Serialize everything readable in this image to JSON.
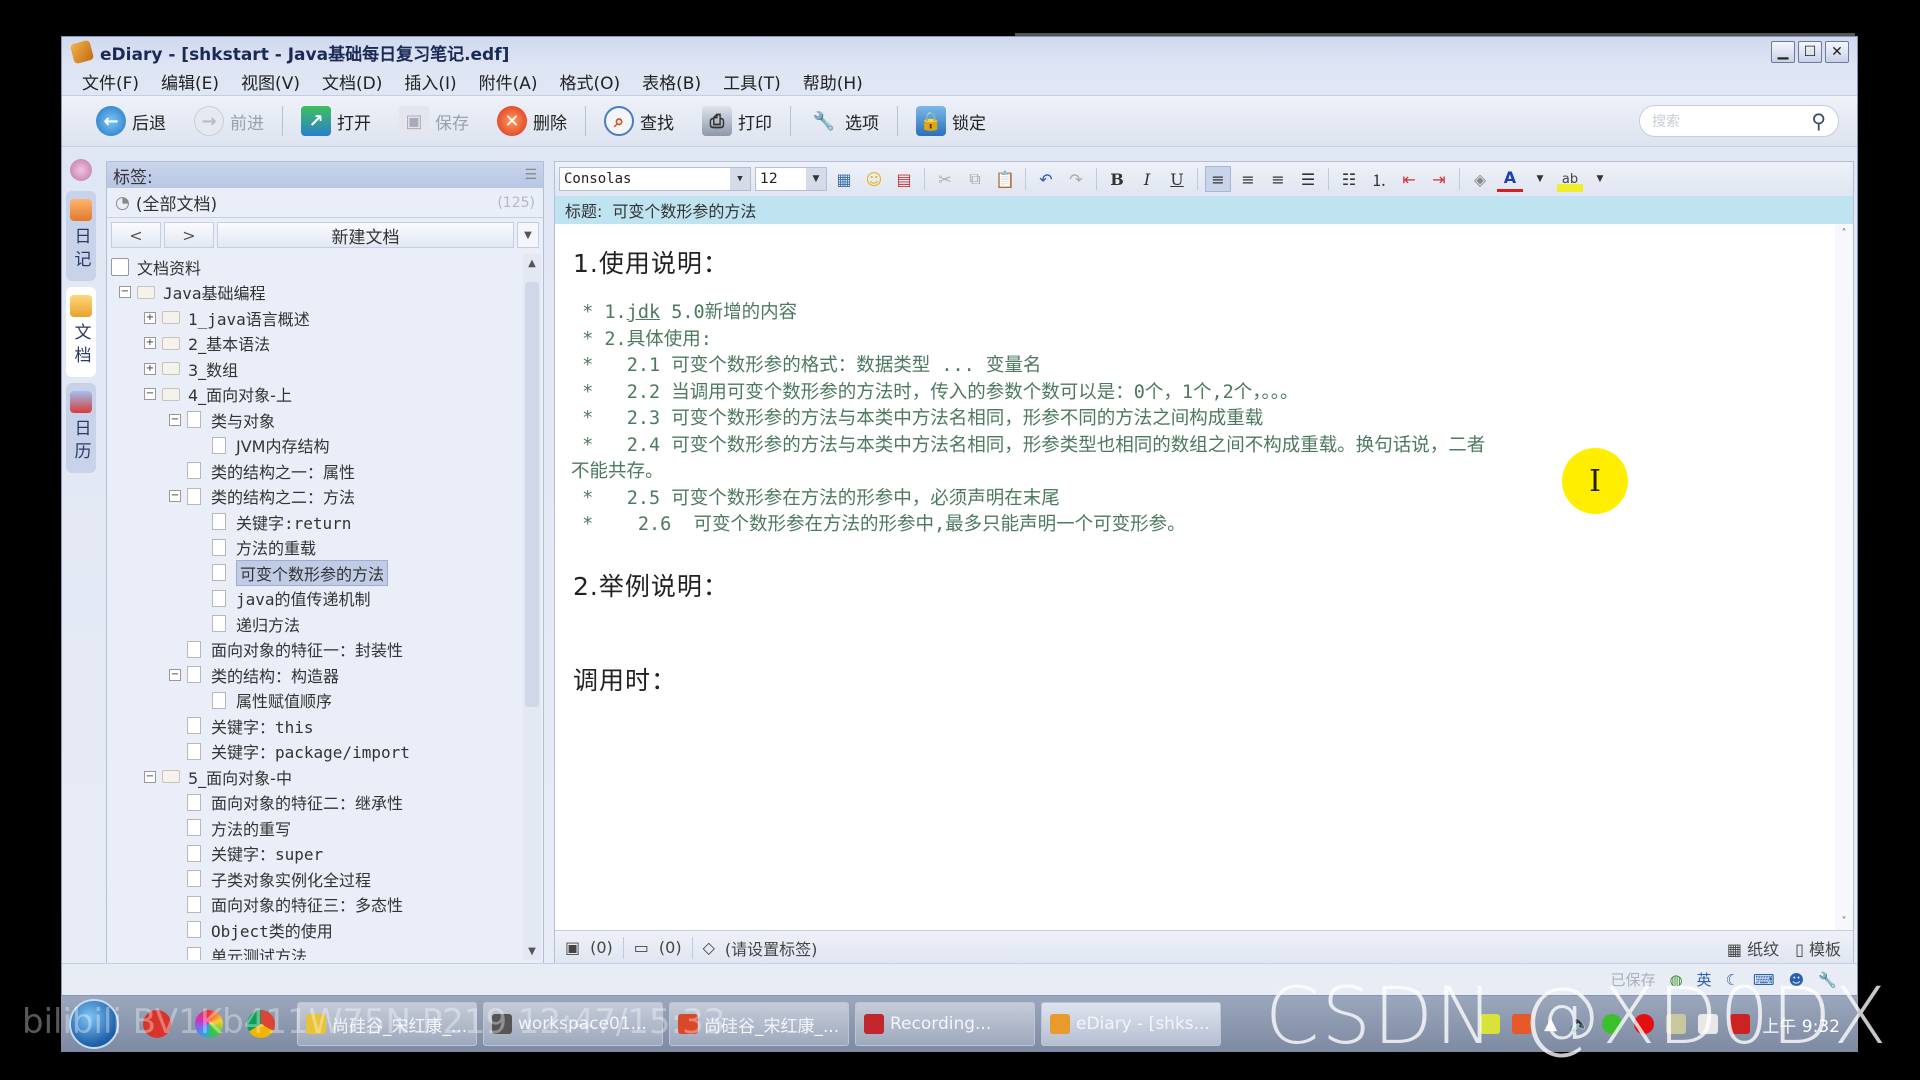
{
  "window": {
    "title": "eDiary - [shkstart - Java基础每日复习笔记.edf]",
    "controls": {
      "minimize": "▁",
      "maximize": "☐",
      "close": "✕"
    }
  },
  "menu": [
    "文件(F)",
    "编辑(E)",
    "视图(V)",
    "文档(D)",
    "插入(I)",
    "附件(A)",
    "格式(O)",
    "表格(B)",
    "工具(T)",
    "帮助(H)"
  ],
  "toolbar": {
    "back": "后退",
    "forward": "前进",
    "open": "打开",
    "save": "保存",
    "delete": "删除",
    "find": "查找",
    "print": "打印",
    "options": "选项",
    "lock": "锁定",
    "search_placeholder": "搜索"
  },
  "vnav": [
    {
      "label": "日记",
      "icon": "diary-icon"
    },
    {
      "label": "文档",
      "icon": "document-icon"
    },
    {
      "label": "日历",
      "icon": "calendar-icon"
    }
  ],
  "left_panel": {
    "tags_label": "标签:",
    "all_docs": "(全部文档)",
    "all_docs_count": "(125)",
    "prev": "<",
    "next": ">",
    "new_doc": "新建文档",
    "tree_root": "文档资料",
    "tree": [
      {
        "label": "Java基础编程",
        "level": 0,
        "type": "folder",
        "exp": "−"
      },
      {
        "label": "1_java语言概述",
        "level": 1,
        "type": "folder",
        "exp": "+"
      },
      {
        "label": "2_基本语法",
        "level": 1,
        "type": "folder",
        "exp": "+"
      },
      {
        "label": "3_数组",
        "level": 1,
        "type": "folder",
        "exp": "+"
      },
      {
        "label": "4_面向对象-上",
        "level": 1,
        "type": "folder",
        "exp": "−"
      },
      {
        "label": "类与对象",
        "level": 2,
        "type": "doc",
        "exp": "−"
      },
      {
        "label": "JVM内存结构",
        "level": 3,
        "type": "doc",
        "exp": ""
      },
      {
        "label": "类的结构之一：属性",
        "level": 2,
        "type": "doc",
        "exp": ""
      },
      {
        "label": "类的结构之二：方法",
        "level": 2,
        "type": "doc",
        "exp": "−"
      },
      {
        "label": "关键字:return",
        "level": 3,
        "type": "doc",
        "exp": ""
      },
      {
        "label": "方法的重载",
        "level": 3,
        "type": "doc",
        "exp": ""
      },
      {
        "label": "可变个数形参的方法",
        "level": 3,
        "type": "doc",
        "exp": "",
        "selected": true
      },
      {
        "label": "java的值传递机制",
        "level": 3,
        "type": "doc",
        "exp": ""
      },
      {
        "label": "递归方法",
        "level": 3,
        "type": "doc",
        "exp": ""
      },
      {
        "label": "面向对象的特征一：封装性",
        "level": 2,
        "type": "doc",
        "exp": ""
      },
      {
        "label": "类的结构：构造器",
        "level": 2,
        "type": "doc",
        "exp": "−"
      },
      {
        "label": "属性赋值顺序",
        "level": 3,
        "type": "doc",
        "exp": ""
      },
      {
        "label": "关键字：this",
        "level": 2,
        "type": "doc",
        "exp": ""
      },
      {
        "label": "关键字：package/import",
        "level": 2,
        "type": "doc",
        "exp": ""
      },
      {
        "label": "5_面向对象-中",
        "level": 1,
        "type": "folder",
        "exp": "−"
      },
      {
        "label": "面向对象的特征二：继承性",
        "level": 2,
        "type": "doc",
        "exp": ""
      },
      {
        "label": "方法的重写",
        "level": 2,
        "type": "doc",
        "exp": ""
      },
      {
        "label": "关键字：super",
        "level": 2,
        "type": "doc",
        "exp": ""
      },
      {
        "label": "子类对象实例化全过程",
        "level": 2,
        "type": "doc",
        "exp": ""
      },
      {
        "label": "面向对象的特征三：多态性",
        "level": 2,
        "type": "doc",
        "exp": ""
      },
      {
        "label": "Object类的使用",
        "level": 2,
        "type": "doc",
        "exp": ""
      },
      {
        "label": "单元测试方法",
        "level": 2,
        "type": "doc",
        "exp": ""
      }
    ]
  },
  "editor": {
    "font": "Consolas",
    "size": "12",
    "title_label": "标题:",
    "title": "可变个数形参的方法",
    "heading1": "1.使用说明：",
    "lines": [
      " * 1.jdk 5.0新增的内容",
      " * 2.具体使用:",
      " *   2.1 可变个数形参的格式：数据类型 ... 变量名",
      " *   2.2 当调用可变个数形参的方法时，传入的参数个数可以是：0个，1个,2个，。。。",
      " *   2.3 可变个数形参的方法与本类中方法名相同，形参不同的方法之间构成重载",
      " *   2.4 可变个数形参的方法与本类中方法名相同，形参类型也相同的数组之间不构成重载。换句话说，二者",
      "不能共存。",
      " *   2.5 可变个数形参在方法的形参中，必须声明在末尾",
      " *    2.6  可变个数形参在方法的形参中,最多只能声明一个可变形参。"
    ],
    "heading2": "2.举例说明：",
    "heading3": "调用时：",
    "status": {
      "attachments": "(0)",
      "comments": "(0)",
      "tag_prompt": "(请设置标签)",
      "paper": "纸纹",
      "template": "模板"
    }
  },
  "window_status": {
    "saved": "已保存",
    "ime": "英"
  },
  "taskbar": {
    "tasks": [
      {
        "label": "尚硅谷_宋红康_...",
        "color": "#e8c23a"
      },
      {
        "label": "workspace01...",
        "color": "#555"
      },
      {
        "label": "尚硅谷_宋红康_...",
        "color": "#d9482b"
      },
      {
        "label": "Recording...",
        "color": "#c0262b"
      },
      {
        "label": "eDiary - [shks...",
        "color": "#e89b2c",
        "active": true
      }
    ],
    "clock": "上午 9:32"
  },
  "watermarks": {
    "csdn": "CSDN @XD0DX",
    "bili": "bilibili BV1Kb411W75N P219 12:47/15:33"
  }
}
